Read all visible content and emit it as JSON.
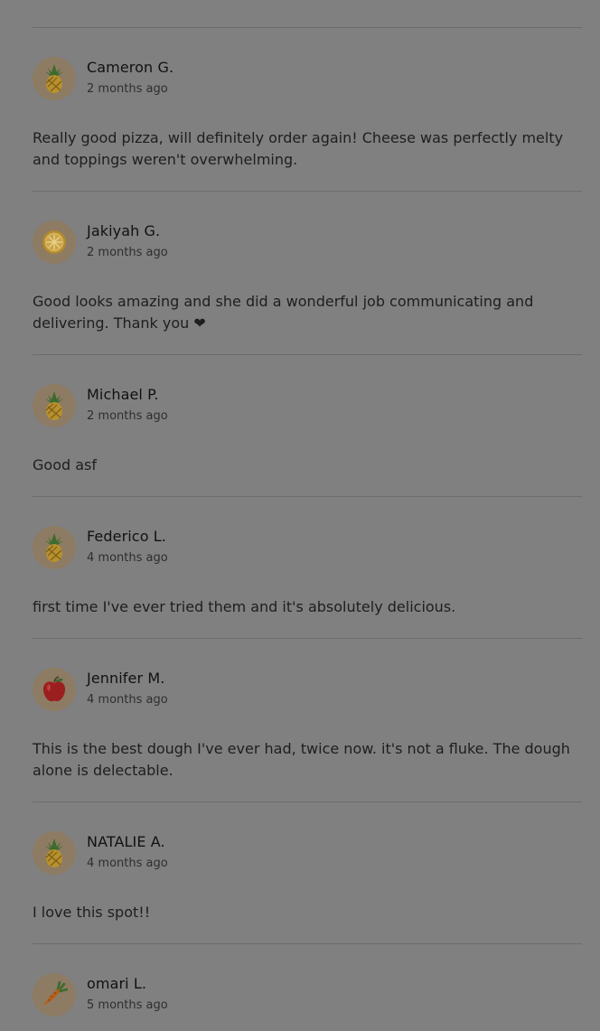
{
  "reviews": [
    {
      "name": "Cameron G.",
      "time": "2 months ago",
      "text": "Really good pizza, will definitely order again! Cheese was perfectly melty and toppings weren't overwhelming.",
      "avatar_icon": "pineapple-icon"
    },
    {
      "name": "Jakiyah G.",
      "time": "2 months ago",
      "text": "Good looks amazing and she did a wonderful job communicating and delivering. Thank you ❤",
      "avatar_icon": "lemon-slice-icon"
    },
    {
      "name": "Michael P.",
      "time": "2 months ago",
      "text": "Good asf",
      "avatar_icon": "pineapple-icon"
    },
    {
      "name": "Federico L.",
      "time": "4 months ago",
      "text": "first time I've ever tried them and it's absolutely delicious.",
      "avatar_icon": "pineapple-icon"
    },
    {
      "name": "Jennifer M.",
      "time": "4 months ago",
      "text": "This is the best dough I've ever had, twice now. it's not a fluke. The dough alone is delectable.",
      "avatar_icon": "apple-icon"
    },
    {
      "name": "NATALIE A.",
      "time": "4 months ago",
      "text": "I love this spot!!",
      "avatar_icon": "pineapple-icon"
    },
    {
      "name": "omari L.",
      "time": "5 months ago",
      "text": "",
      "avatar_icon": "carrot-icon"
    }
  ]
}
